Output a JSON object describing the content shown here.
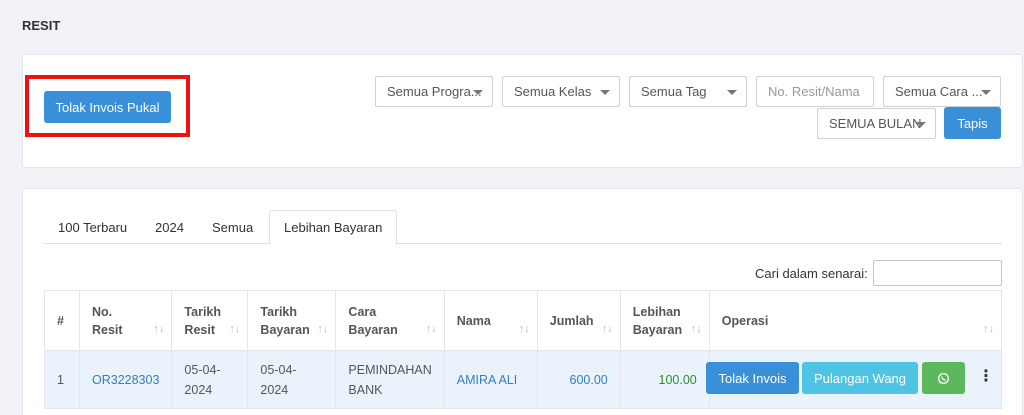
{
  "page": {
    "title": "RESIT"
  },
  "toolbar": {
    "bulk_reject_label": "Tolak Invois Pukal",
    "filters": {
      "program": "Semua Progra...",
      "kelas": "Semua Kelas",
      "tag": "Semua Tag",
      "search_placeholder": "No. Resit/Nama",
      "cara": "Semua Cara ...",
      "bulan": "SEMUA BULAN"
    },
    "filter_button_label": "Tapis"
  },
  "tabs": [
    "100 Terbaru",
    "2024",
    "Semua",
    "Lebihan Bayaran"
  ],
  "active_tab": "Lebihan Bayaran",
  "list_search": {
    "label": "Cari dalam senarai:"
  },
  "table": {
    "headers": {
      "idx": "#",
      "no_resit_1": "No.",
      "no_resit_2": "Resit",
      "tarikh_resit_1": "Tarikh",
      "tarikh_resit_2": "Resit",
      "tarikh_bayaran_1": "Tarikh",
      "tarikh_bayaran_2": "Bayaran",
      "cara_1": "Cara",
      "cara_2": "Bayaran",
      "nama": "Nama",
      "jumlah": "Jumlah",
      "lebihan_1": "Lebihan",
      "lebihan_2": "Bayaran",
      "operasi": "Operasi",
      "sort_icon": "↑↓"
    },
    "rows": [
      {
        "idx": "1",
        "no_resit": "OR3228303",
        "tarikh_resit_1": "05-04-",
        "tarikh_resit_2": "2024",
        "tarikh_bayaran_1": "05-04-",
        "tarikh_bayaran_2": "2024",
        "cara_1": "PEMINDAHAN",
        "cara_2": "BANK",
        "nama": "AMIRA ALI",
        "jumlah": "600.00",
        "lebihan": "100.00",
        "actions": {
          "reject": "Tolak Invois",
          "refund": "Pulangan Wang",
          "whatsapp_icon": "whatsapp-icon",
          "more_icon": "kebab-icon"
        }
      }
    ]
  }
}
